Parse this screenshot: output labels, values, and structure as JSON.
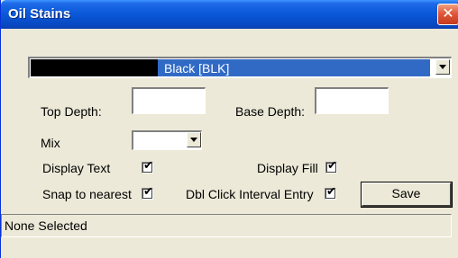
{
  "window": {
    "title": "Oil Stains",
    "close_glyph": "✕"
  },
  "color_combo": {
    "selected_label": "Black [BLK]",
    "swatch_color": "#000000",
    "highlight_color": "#316ac5"
  },
  "fields": {
    "top_depth_label": "Top Depth:",
    "top_depth_value": "",
    "base_depth_label": "Base Depth:",
    "base_depth_value": "",
    "mix_label": "Mix",
    "mix_value": ""
  },
  "options": {
    "display_text_label": "Display Text",
    "display_text_checked": true,
    "display_fill_label": "Display Fill",
    "display_fill_checked": true,
    "snap_label": "Snap to nearest",
    "snap_checked": true,
    "dbl_click_label": "Dbl Click Interval Entry",
    "dbl_click_checked": true
  },
  "buttons": {
    "save_label": "Save"
  },
  "status": {
    "text": "None Selected"
  },
  "icons": {
    "close": "close-icon",
    "dropdown": "chevron-down-icon",
    "check": "check-icon"
  }
}
